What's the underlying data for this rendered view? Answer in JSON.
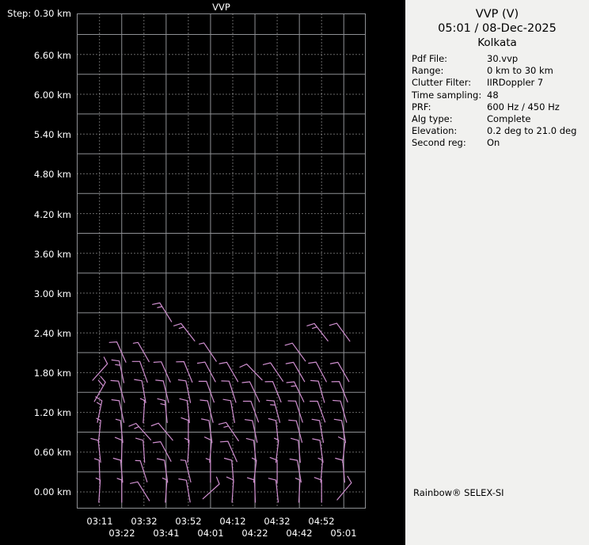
{
  "colors": {
    "background": "#000000",
    "panel_background": "#f1f1ef",
    "grid_solid": "#8e9094",
    "grid_dotted": "#cccccc",
    "barb": "#cf8fcf",
    "plot_text": "#ffffff",
    "panel_text": "#000000"
  },
  "panel": {
    "title": "VVP (V)",
    "datetime": "05:01 / 08-Dec-2025",
    "site": "Kolkata",
    "params": [
      {
        "label": "Pdf File:",
        "value": "30.vvp"
      },
      {
        "label": "Range:",
        "value": "0 km to 30 km"
      },
      {
        "label": "Clutter Filter:",
        "value": "IIRDoppler 7"
      },
      {
        "label": "Time sampling:",
        "value": "48"
      },
      {
        "label": "PRF:",
        "value": "600 Hz / 450 Hz"
      },
      {
        "label": "Alg type:",
        "value": "Complete"
      },
      {
        "label": "Elevation:",
        "value": "0.2 deg to 21.0 deg"
      },
      {
        "label": "Second reg:",
        "value": "On"
      }
    ],
    "brand": "Rainbow® SELEX-SI"
  },
  "chart_data": {
    "type": "wind-barb-time-height-profile",
    "title": "VVP",
    "y_step_label": "Step: 0.30 km",
    "y_ticks": [
      "6.60 km",
      "6.00 km",
      "5.40 km",
      "4.80 km",
      "4.20 km",
      "3.60 km",
      "3.00 km",
      "2.40 km",
      "1.80 km",
      "1.20 km",
      "0.60 km",
      "0.00 km"
    ],
    "y_unit": "km",
    "y_range_km": [
      0.0,
      7.2
    ],
    "y_step_km": 0.3,
    "x_categories": [
      "03:11",
      "03:22",
      "03:32",
      "03:41",
      "03:52",
      "04:01",
      "04:12",
      "04:22",
      "04:32",
      "04:42",
      "04:52",
      "05:01"
    ],
    "grid": "solid-major-dotted-minor",
    "legend": "none",
    "barb_convention": "staff points toward wind origin; full tick = 10 kt, half tick = 5 kt",
    "barbs_format": [
      "time_index",
      "height_km",
      "staff_dir_deg_from_vertical",
      "full_ticks",
      "half_ticks"
    ],
    "barbs": [
      [
        0,
        0.0,
        4,
        0,
        1
      ],
      [
        0,
        0.3,
        -2,
        0,
        1
      ],
      [
        0,
        0.6,
        -6,
        1,
        0
      ],
      [
        0,
        0.9,
        6,
        0,
        1
      ],
      [
        0,
        1.2,
        12,
        1,
        1
      ],
      [
        0,
        1.5,
        30,
        2,
        0
      ],
      [
        0,
        1.8,
        42,
        1,
        0
      ],
      [
        1,
        0.0,
        0,
        0,
        1
      ],
      [
        1,
        0.3,
        -5,
        1,
        0
      ],
      [
        1,
        0.6,
        2,
        1,
        0
      ],
      [
        1,
        0.9,
        -6,
        0,
        1
      ],
      [
        1,
        1.2,
        -12,
        1,
        0
      ],
      [
        1,
        1.5,
        -16,
        1,
        0
      ],
      [
        1,
        1.8,
        -12,
        1,
        1
      ],
      [
        1,
        2.1,
        -24,
        1,
        0
      ],
      [
        2,
        0.0,
        -32,
        1,
        0
      ],
      [
        2,
        0.3,
        -18,
        0,
        1
      ],
      [
        2,
        0.6,
        -4,
        1,
        0
      ],
      [
        2,
        0.9,
        -42,
        1,
        1
      ],
      [
        2,
        1.2,
        4,
        0,
        1
      ],
      [
        2,
        1.5,
        -10,
        1,
        0
      ],
      [
        2,
        1.8,
        -20,
        1,
        0
      ],
      [
        2,
        2.1,
        -30,
        0,
        1
      ],
      [
        3,
        0.0,
        4,
        0,
        1
      ],
      [
        3,
        0.3,
        -8,
        1,
        0
      ],
      [
        3,
        0.6,
        -28,
        1,
        0
      ],
      [
        3,
        0.9,
        -40,
        1,
        0
      ],
      [
        3,
        1.2,
        -6,
        1,
        1
      ],
      [
        3,
        1.5,
        -14,
        1,
        0
      ],
      [
        3,
        1.8,
        -24,
        1,
        0
      ],
      [
        3,
        2.7,
        -32,
        1,
        1
      ],
      [
        4,
        0.0,
        -10,
        1,
        0
      ],
      [
        4,
        0.3,
        -14,
        0,
        1
      ],
      [
        4,
        0.6,
        4,
        0,
        1
      ],
      [
        4,
        0.9,
        0,
        1,
        0
      ],
      [
        4,
        1.2,
        -6,
        1,
        0
      ],
      [
        4,
        1.5,
        -12,
        1,
        0
      ],
      [
        4,
        1.8,
        -22,
        1,
        0
      ],
      [
        4,
        2.4,
        -38,
        1,
        1
      ],
      [
        5,
        0.0,
        48,
        1,
        0
      ],
      [
        5,
        0.3,
        0,
        0,
        1
      ],
      [
        5,
        0.6,
        5,
        1,
        0
      ],
      [
        5,
        0.9,
        -8,
        1,
        0
      ],
      [
        5,
        1.2,
        -14,
        1,
        0
      ],
      [
        5,
        1.5,
        -20,
        1,
        0
      ],
      [
        5,
        1.8,
        -28,
        1,
        0
      ],
      [
        5,
        2.1,
        -34,
        0,
        1
      ],
      [
        6,
        0.0,
        4,
        1,
        0
      ],
      [
        6,
        0.3,
        -5,
        1,
        0
      ],
      [
        6,
        0.6,
        -24,
        1,
        0
      ],
      [
        6,
        0.9,
        -34,
        1,
        1
      ],
      [
        6,
        1.2,
        -10,
        1,
        0
      ],
      [
        6,
        1.5,
        -18,
        1,
        0
      ],
      [
        6,
        1.8,
        -30,
        1,
        0
      ],
      [
        7,
        0.0,
        -2,
        1,
        0
      ],
      [
        7,
        0.3,
        7,
        0,
        1
      ],
      [
        7,
        0.6,
        -6,
        1,
        0
      ],
      [
        7,
        0.9,
        -12,
        1,
        0
      ],
      [
        7,
        1.2,
        -20,
        1,
        0
      ],
      [
        7,
        1.5,
        -26,
        1,
        0
      ],
      [
        7,
        1.8,
        -44,
        1,
        0
      ],
      [
        8,
        0.0,
        -6,
        1,
        0
      ],
      [
        8,
        0.3,
        0,
        1,
        0
      ],
      [
        8,
        0.6,
        7,
        0,
        1
      ],
      [
        8,
        0.9,
        -6,
        1,
        0
      ],
      [
        8,
        1.2,
        -15,
        1,
        1
      ],
      [
        8,
        1.5,
        -22,
        1,
        0
      ],
      [
        8,
        1.8,
        -34,
        1,
        0
      ],
      [
        9,
        0.0,
        3,
        0,
        1
      ],
      [
        9,
        0.3,
        -10,
        1,
        0
      ],
      [
        9,
        0.6,
        -5,
        1,
        0
      ],
      [
        9,
        0.9,
        -15,
        1,
        0
      ],
      [
        9,
        1.2,
        -18,
        1,
        0
      ],
      [
        9,
        1.5,
        -26,
        1,
        1
      ],
      [
        9,
        1.8,
        -30,
        1,
        0
      ],
      [
        9,
        2.1,
        -36,
        1,
        0
      ],
      [
        10,
        0.0,
        0,
        1,
        0
      ],
      [
        10,
        0.3,
        5,
        0,
        1
      ],
      [
        10,
        0.6,
        -8,
        1,
        0
      ],
      [
        10,
        0.9,
        -10,
        1,
        0
      ],
      [
        10,
        1.2,
        -20,
        1,
        0
      ],
      [
        10,
        1.5,
        -16,
        1,
        0
      ],
      [
        10,
        1.8,
        -28,
        1,
        0
      ],
      [
        10,
        2.4,
        -38,
        1,
        1
      ],
      [
        11,
        0.0,
        40,
        1,
        0
      ],
      [
        11,
        0.3,
        -5,
        1,
        0
      ],
      [
        11,
        0.6,
        7,
        1,
        0
      ],
      [
        11,
        0.9,
        -10,
        1,
        0
      ],
      [
        11,
        1.2,
        -16,
        1,
        0
      ],
      [
        11,
        1.5,
        -22,
        1,
        0
      ],
      [
        11,
        1.8,
        -30,
        1,
        0
      ],
      [
        11,
        2.4,
        -36,
        1,
        0
      ]
    ]
  }
}
